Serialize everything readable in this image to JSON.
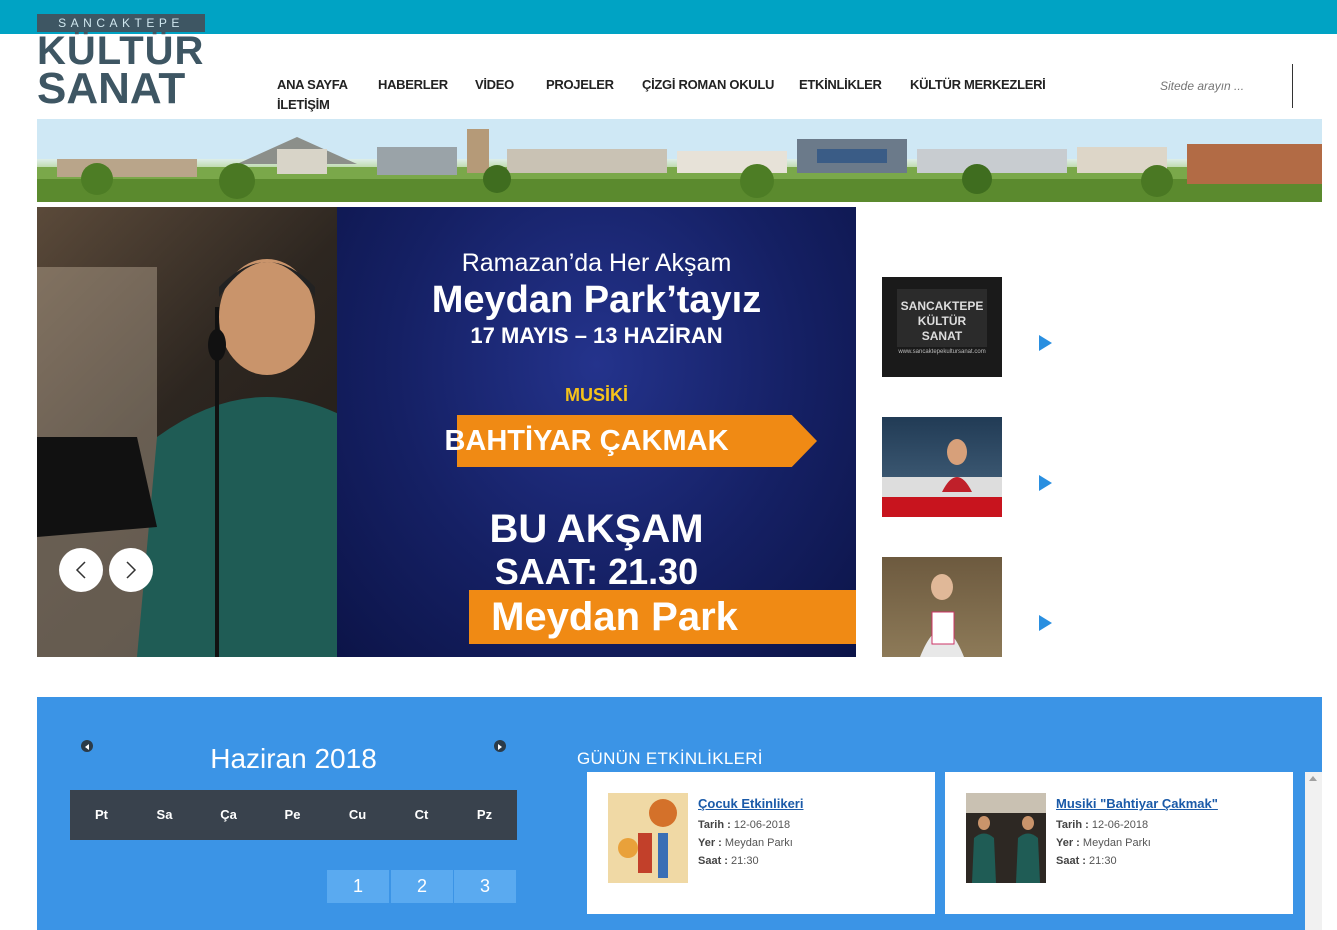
{
  "logo": {
    "top_text": "SANCAKTEPE",
    "line1": "KÜLTÜR",
    "line2": "SANAT"
  },
  "nav": {
    "items": [
      "ANA SAYFA",
      "HABERLER",
      "VİDEO",
      "PROJELER",
      "ÇİZGİ ROMAN OKULU",
      "ETKİNLİKLER",
      "KÜLTÜR MERKEZLERİ",
      "İLETİŞİM"
    ]
  },
  "search": {
    "placeholder": "Sitede arayın ..."
  },
  "slider": {
    "line1": "Ramazan’da Her Akşam",
    "line2": "Meydan Park’tayız",
    "line3": "17 MAYIS – 13 HAZİRAN",
    "line4": "MUSİKİ",
    "line5": "BAHTİYAR ÇAKMAK",
    "line6": "BU AKŞAM",
    "line7": "SAAT: 21.30",
    "line8": "Meydan Park"
  },
  "thumbs": [
    {
      "text": "SANCAKTEPE KÜLTÜR SANAT",
      "url": "www.sancaktepekultursanat.com"
    },
    {
      "text": ""
    },
    {
      "text": ""
    }
  ],
  "calendar": {
    "title": "Haziran 2018",
    "days": [
      "Pt",
      "Sa",
      "Ça",
      "Pe",
      "Cu",
      "Ct",
      "Pz"
    ],
    "pages": [
      "1",
      "2",
      "3"
    ]
  },
  "events": {
    "title": "GÜNÜN ETKİNLİKLERİ",
    "date_label": "Tarih :",
    "place_label": "Yer :",
    "time_label": "Saat :",
    "items": [
      {
        "title": "Çocuk Etkinlikeri",
        "date": "12-06-2018",
        "place": "Meydan Parkı",
        "time": "21:30"
      },
      {
        "title": "Musiki \"Bahtiyar Çakmak\"",
        "date": "12-06-2018",
        "place": "Meydan Parkı",
        "time": "21:30"
      }
    ]
  },
  "colors": {
    "topbar": "#00a3c4",
    "blue_section": "#3b94e6",
    "accent_orange": "#f08a14"
  }
}
